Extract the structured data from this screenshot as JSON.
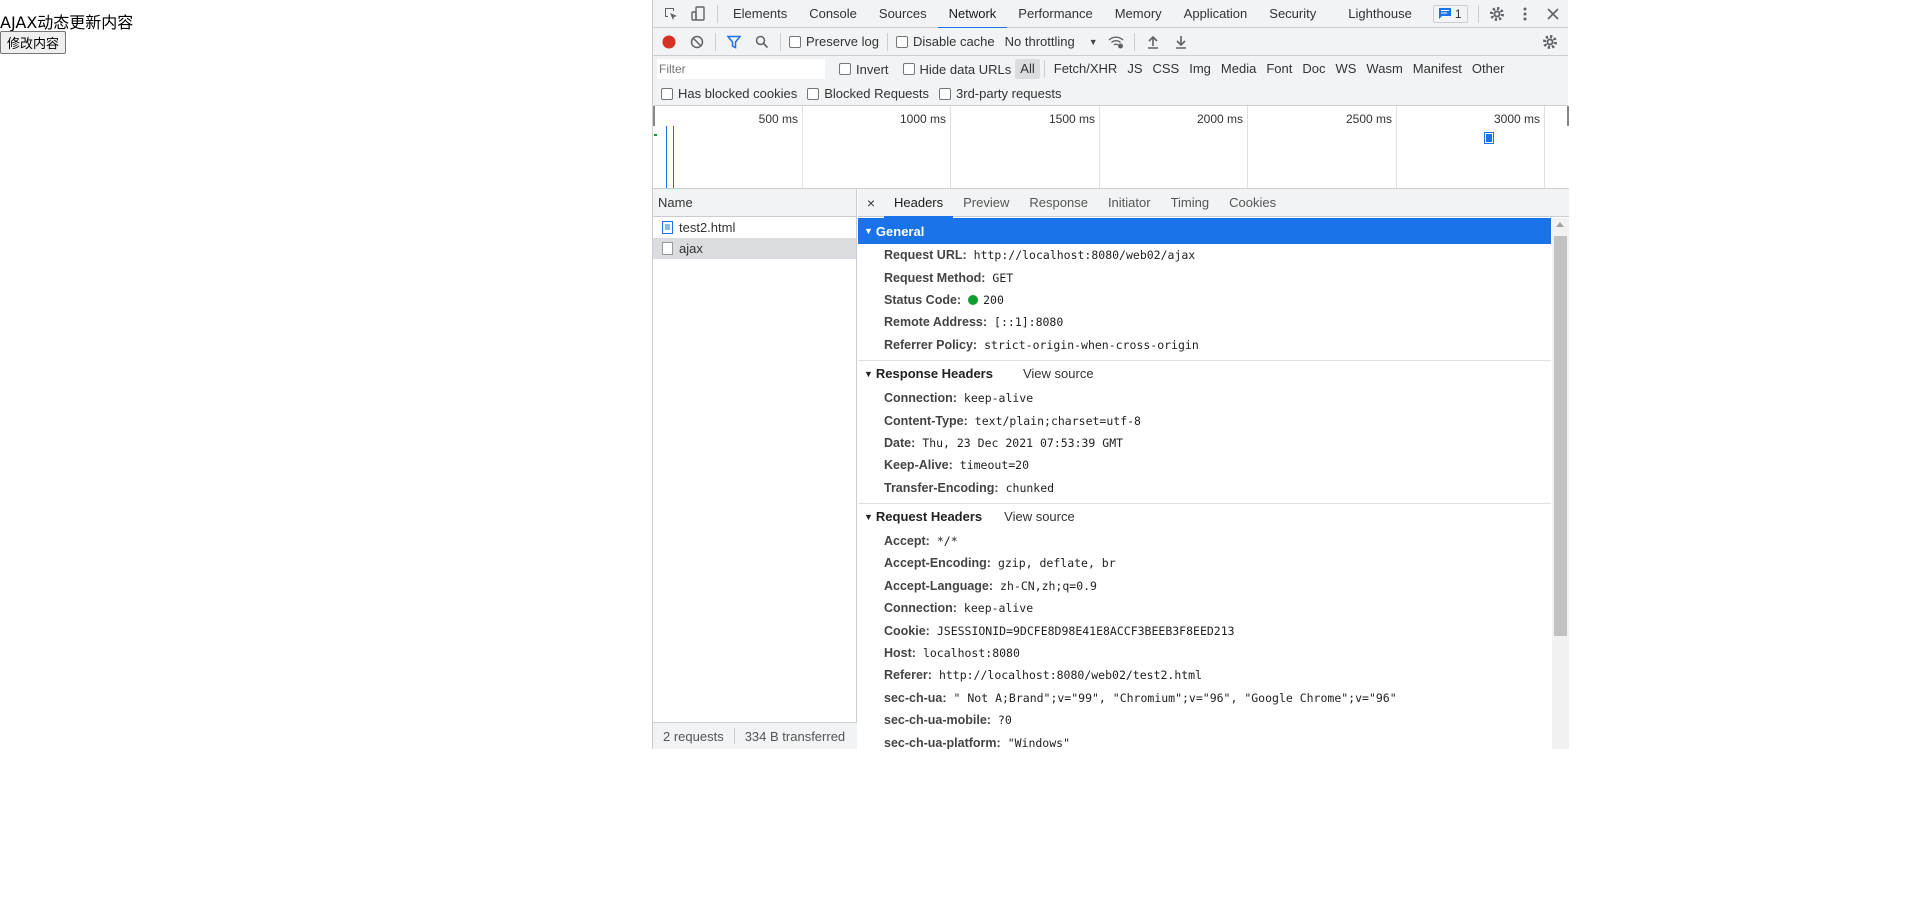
{
  "page": {
    "heading": "AJAX动态更新内容",
    "button_label": "修改内容"
  },
  "devtools": {
    "tabs": [
      "Elements",
      "Console",
      "Sources",
      "Network",
      "Performance",
      "Memory",
      "Application",
      "Security",
      "Lighthouse"
    ],
    "active_tab": "Network",
    "issues_count": "1",
    "toolbar": {
      "preserve_log": "Preserve log",
      "disable_cache": "Disable cache",
      "throttling": "No throttling"
    },
    "filter": {
      "placeholder": "Filter",
      "invert": "Invert",
      "hide_data_urls": "Hide data URLs",
      "types": [
        "All",
        "Fetch/XHR",
        "JS",
        "CSS",
        "Img",
        "Media",
        "Font",
        "Doc",
        "WS",
        "Wasm",
        "Manifest",
        "Other"
      ],
      "active_type": "All"
    },
    "blocking": {
      "blocked_cookies": "Has blocked cookies",
      "blocked_requests": "Blocked Requests",
      "third_party": "3rd-party requests"
    },
    "timeline": {
      "labels": [
        "500 ms",
        "1000 ms",
        "1500 ms",
        "2000 ms",
        "2500 ms",
        "3000 ms"
      ]
    },
    "requests": {
      "header": "Name",
      "items": [
        {
          "name": "test2.html",
          "selected": false
        },
        {
          "name": "ajax",
          "selected": true
        }
      ],
      "status": {
        "count": "2 requests",
        "transferred": "334 B transferred"
      }
    },
    "detail": {
      "close": "×",
      "tabs": [
        "Headers",
        "Preview",
        "Response",
        "Initiator",
        "Timing",
        "Cookies"
      ],
      "active_tab": "Headers",
      "view_source": "View source",
      "general": {
        "title": "General",
        "rows": [
          {
            "name": "Request URL:",
            "value": "http://localhost:8080/web02/ajax"
          },
          {
            "name": "Request Method:",
            "value": "GET"
          },
          {
            "name": "Status Code:",
            "value": "200"
          },
          {
            "name": "Remote Address:",
            "value": "[::1]:8080"
          },
          {
            "name": "Referrer Policy:",
            "value": "strict-origin-when-cross-origin"
          }
        ]
      },
      "response_headers": {
        "title": "Response Headers",
        "rows": [
          {
            "name": "Connection:",
            "value": "keep-alive"
          },
          {
            "name": "Content-Type:",
            "value": "text/plain;charset=utf-8"
          },
          {
            "name": "Date:",
            "value": "Thu, 23 Dec 2021 07:53:39 GMT"
          },
          {
            "name": "Keep-Alive:",
            "value": "timeout=20"
          },
          {
            "name": "Transfer-Encoding:",
            "value": "chunked"
          }
        ]
      },
      "request_headers": {
        "title": "Request Headers",
        "rows": [
          {
            "name": "Accept:",
            "value": "*/*"
          },
          {
            "name": "Accept-Encoding:",
            "value": "gzip, deflate, br"
          },
          {
            "name": "Accept-Language:",
            "value": "zh-CN,zh;q=0.9"
          },
          {
            "name": "Connection:",
            "value": "keep-alive"
          },
          {
            "name": "Cookie:",
            "value": "JSESSIONID=9DCFE8D98E41E8ACCF3BEEB3F8EED213"
          },
          {
            "name": "Host:",
            "value": "localhost:8080"
          },
          {
            "name": "Referer:",
            "value": "http://localhost:8080/web02/test2.html"
          },
          {
            "name": "sec-ch-ua:",
            "value": "\" Not A;Brand\";v=\"99\", \"Chromium\";v=\"96\", \"Google Chrome\";v=\"96\""
          },
          {
            "name": "sec-ch-ua-mobile:",
            "value": "?0"
          },
          {
            "name": "sec-ch-ua-platform:",
            "value": "\"Windows\""
          }
        ]
      }
    },
    "colors": {
      "accent": "#1a73e8",
      "record": "#d93025",
      "status_ok": "#0f9d2f"
    }
  }
}
